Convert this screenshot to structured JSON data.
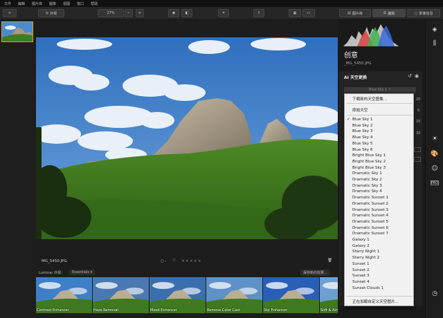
{
  "menubar": {
    "items": [
      "文件",
      "編輯",
      "图片库",
      "圖像",
      "视图",
      "窗口",
      "帮助"
    ]
  },
  "toolbar": {
    "add_label": "+",
    "appearance_label": "外观",
    "zoom_value": "27%",
    "zoom_minus": "−",
    "zoom_plus": "+",
    "tab_library": "图片库",
    "tab_edit": "编辑",
    "tab_info": "影像信息"
  },
  "filmstrip": {
    "thumb_alt": "MG_5450"
  },
  "image": {
    "filename": "MG_5450.JPG"
  },
  "rating": {
    "stars": 0,
    "star_glyphs": "★★★★★",
    "flag": "○ -",
    "heart": "♡"
  },
  "looks": {
    "label": "Luminar 外观：",
    "category": "Essentials ▾",
    "save_label": "保存新的效果…",
    "items": [
      "Contrast Enhancer",
      "Haze Removal",
      "Mood Enhancer",
      "Remove Color Cast",
      "Sky Enhancer",
      "Soft & Airy"
    ]
  },
  "panel": {
    "title": "创意",
    "filename": "_MG_5450.JPG",
    "section_title": "AI 天空更换",
    "current_sky": "Blue Sky 1 ~",
    "slider_values": [
      "20",
      "0",
      "20",
      "30"
    ]
  },
  "dropdown": {
    "download_item": "下载新的天空图像...",
    "original_item": "原始天空",
    "sky_items": [
      "Blue Sky 1",
      "Blue Sky 2",
      "Blue Sky 3",
      "Blue Sky 4",
      "Blue Sky 5",
      "Blue Sky 6",
      "Bright Blue Sky 1",
      "Bright Blue Sky 2",
      "Bright Blue Sky 3",
      "Dramatic Sky 1",
      "Dramatic Sky 2",
      "Dramatic Sky 3",
      "Dramatic Sky 4",
      "Dramatic Sunset 1",
      "Dramatic Sunset 2",
      "Dramatic Sunset 3",
      "Dramatic Sunset 4",
      "Dramatic Sunset 5",
      "Dramatic Sunset 6",
      "Dramatic Sunset 7",
      "Galaxy 1",
      "Galaxy 2",
      "Starry Night 1",
      "Starry Night 2",
      "Sunset 1",
      "Sunset 2",
      "Sunset 3",
      "Sunset 4",
      "Sunset Clouds 1"
    ],
    "selected_index": 0,
    "check_glyph": "✓",
    "load_custom_item": "正在加载自定义天空图片..."
  },
  "right_icons": {
    "layers": "layers-icon",
    "adjust": "adjust-icon",
    "sun": "sun-icon",
    "palette": "palette-icon",
    "face": "face-icon",
    "pro": "PRO",
    "history": "history-icon"
  },
  "colors": {
    "accent": "#e8a000",
    "sky": "#3d7cc4",
    "grass": "#3d7a1f"
  }
}
